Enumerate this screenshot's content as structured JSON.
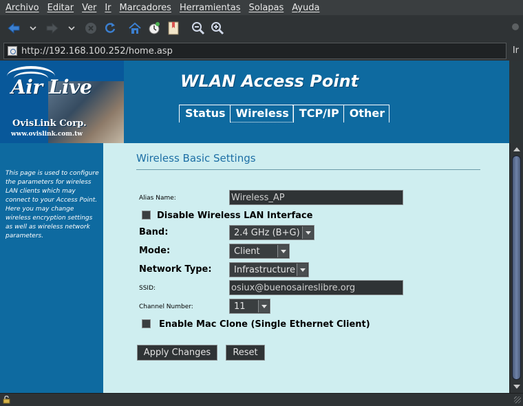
{
  "menu": [
    "Archivo",
    "Editar",
    "Ver",
    "Ir",
    "Marcadores",
    "Herramientas",
    "Solapas",
    "Ayuda"
  ],
  "toolbar": {
    "back": "back-arrow-icon",
    "forward": "forward-arrow-icon",
    "stop": "stop-icon",
    "reload": "reload-icon",
    "home": "home-icon",
    "history": "history-icon",
    "bookmarks": "bookmark-icon",
    "zoom_out": "zoom-out-icon",
    "zoom_in": "zoom-in-icon"
  },
  "address": {
    "url": "http://192.168.100.252/home.asp",
    "go_label": "Ir"
  },
  "header": {
    "logo_text": "Air Live",
    "logo_corp": "OvisLink Corp.",
    "logo_web": "www.ovislink.com.tw",
    "title": "WLAN Access Point",
    "nav": [
      {
        "label": "Status"
      },
      {
        "label": "Wireless"
      },
      {
        "label": "TCP/IP"
      },
      {
        "label": "Other"
      }
    ]
  },
  "sidebar": {
    "description": "This page is used to configure the parameters for wireless LAN clients which may connect to your Access Point. Here you may change wireless encryption settings as well as wireless network parameters."
  },
  "form": {
    "section_title": "Wireless Basic Settings",
    "alias_label": "Alias Name:",
    "alias_value": "Wireless_AP",
    "disable_label": "Disable Wireless LAN Interface",
    "band_label": "Band:",
    "band_value": "2.4 GHz (B+G)",
    "mode_label": "Mode:",
    "mode_value": "Client",
    "network_type_label": "Network Type:",
    "network_type_value": "Infrastructure",
    "ssid_label": "SSID:",
    "ssid_value": "osiux@buenosaireslibre.org",
    "channel_label": "Channel Number:",
    "channel_value": "11",
    "mac_clone_label": "Enable Mac Clone (Single Ethernet Client)",
    "apply_label": "Apply Changes",
    "reset_label": "Reset"
  },
  "colors": {
    "header_blue": "#0e6aa0",
    "content_bg": "#cfeef0",
    "title_blue": "#1d6fa5"
  }
}
